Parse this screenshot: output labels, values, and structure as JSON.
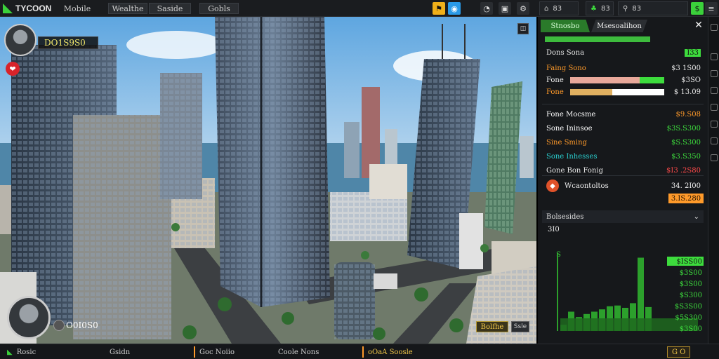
{
  "topbar": {
    "logo": "TYCOON",
    "menus": [
      "Mobile",
      "Wealthe",
      "Saside",
      "Gobls"
    ],
    "right_counts": [
      "83",
      "83"
    ]
  },
  "scene": {
    "player_money": "DO1S9S0",
    "rival_money": "O0I0S0"
  },
  "panel": {
    "tab_active": "Stnosbo",
    "tab_inactive": "Msesoalihon",
    "stats": [
      {
        "label": "Dons Sona",
        "value": "I33",
        "label_color": "#e8e8e8",
        "value_color": "#3ddc3d",
        "bar": null
      },
      {
        "label": "Faing Sono",
        "value": "$3 1S00",
        "label_color": "#ff9a2a",
        "value_color": "#e8e8e8",
        "bar": null
      },
      {
        "label": "Fone",
        "value": "$3SO",
        "label_color": "#f0f0f0",
        "value_color": "#e8e8e8",
        "bar": {
          "level": 0.74,
          "color": "#e8a89a",
          "accent": "#3ddc3d"
        }
      },
      {
        "label": "Fone",
        "value": "$ 13.09",
        "label_color": "#ff9a2a",
        "value_color": "#e8e8e8",
        "bar": {
          "level": 0.45,
          "color": "#e0b060",
          "accent": "#ffffff"
        }
      }
    ],
    "finance": [
      {
        "label": "Fone Mocsme",
        "value": "$9.S08",
        "label_color": "#ffffff",
        "label_accent": "#3ddc3d",
        "value_color": "#ff9a2a"
      },
      {
        "label": "Sone Ininsoe",
        "value": "$3S.S300",
        "label_color": "#ffffff",
        "label_accent": "#3ddc3d",
        "value_color": "#3ddc3d"
      },
      {
        "label": "Sine Sming",
        "value": "$S.S300",
        "label_color": "#ff9a2a",
        "label_accent": "#3ddc3d",
        "value_color": "#3ddc3d"
      },
      {
        "label": "Sone Inhesses",
        "value": "$3.S350",
        "label_color": "#2ad1d1",
        "label_accent": "#3ddc3d",
        "value_color": "#3ddc3d"
      },
      {
        "label": "Gone Bon Fonig",
        "value": "$I3 .2S80",
        "label_color": "#e8e8e8",
        "label_accent": "#e8e8e8",
        "value_color": "#ff4a4a"
      }
    ],
    "alert": {
      "label": "Wcaontoltos",
      "value": "34. 2I00",
      "sub_value": "3.IS.280"
    },
    "chart_section": "Bolsesides",
    "chart_data": {
      "type": "bar",
      "y_top_label": "3I0",
      "y_side_label": "S",
      "values": [
        0.08,
        0.25,
        0.18,
        0.22,
        0.25,
        0.28,
        0.32,
        0.33,
        0.3,
        0.36,
        0.95,
        0.31
      ],
      "labels": [
        "$ISS00",
        "$3S00",
        "$3S00",
        "$S300",
        "$S3S00",
        "$5S300",
        "$3S00"
      ],
      "color": "#2ca02c"
    },
    "buttons": [
      "Bolfhe",
      "Ssle"
    ]
  },
  "bottombar": {
    "items": [
      "Rosic",
      "Gsidn",
      "Goc Noiio",
      "Coole Nons",
      "oOaA Soosle",
      "G O"
    ]
  },
  "colors": {
    "accent": "#3bd13b",
    "orange": "#ff9a2a",
    "panel_bg": "#16181b"
  }
}
